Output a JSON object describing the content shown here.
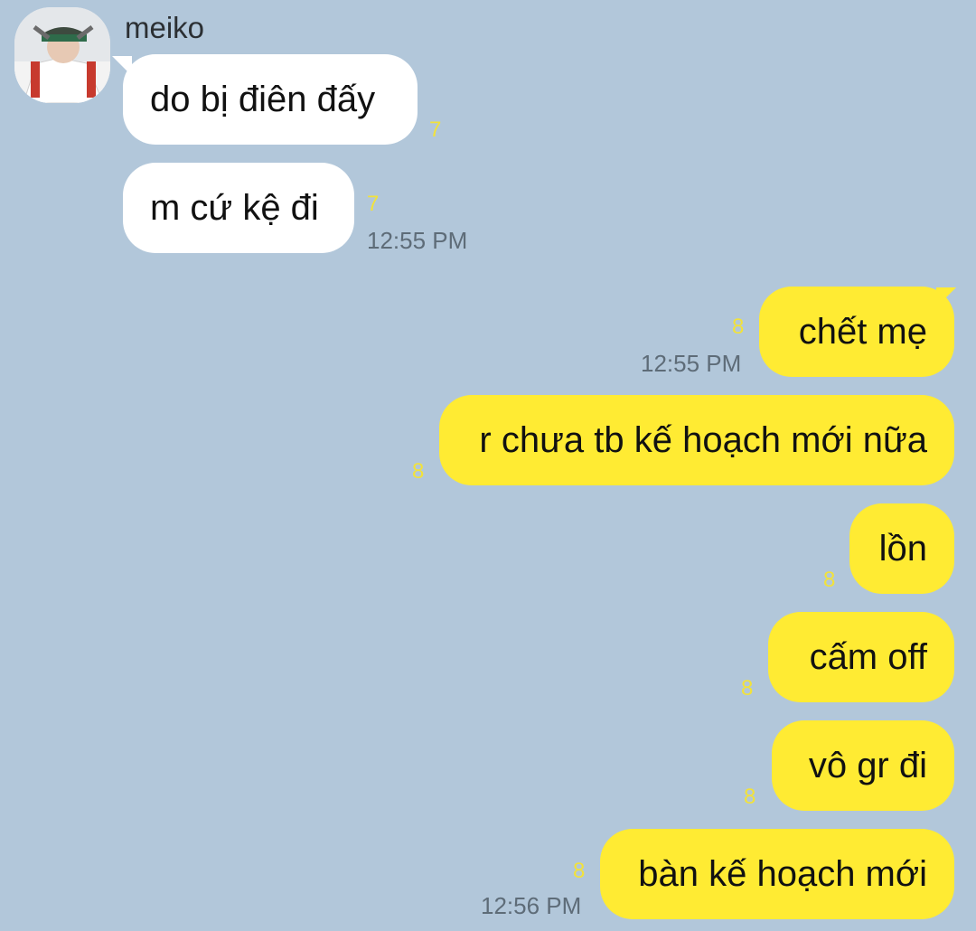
{
  "sender": {
    "name": "meiko"
  },
  "messages_in": [
    {
      "text": "do bị điên đấy",
      "unread": "7"
    },
    {
      "text": "m cứ kệ đi",
      "unread": "7",
      "time": "12:55 PM"
    }
  ],
  "messages_out": [
    {
      "text": "chết mẹ",
      "unread": "8",
      "time": "12:55 PM"
    },
    {
      "text": "r chưa tb kế hoạch mới nữa",
      "unread": "8"
    },
    {
      "text": "lồn",
      "unread": "8"
    },
    {
      "text": "cấm off",
      "unread": "8"
    },
    {
      "text": "vô gr đi",
      "unread": "8"
    },
    {
      "text": "bàn kế hoạch mới",
      "unread": "8",
      "time": "12:56 PM"
    }
  ],
  "colors": {
    "background": "#b2c7da",
    "incoming_bubble": "#ffffff",
    "outgoing_bubble": "#ffeb33",
    "unread_count": "#f2e23a",
    "timestamp": "#5e6c78"
  }
}
